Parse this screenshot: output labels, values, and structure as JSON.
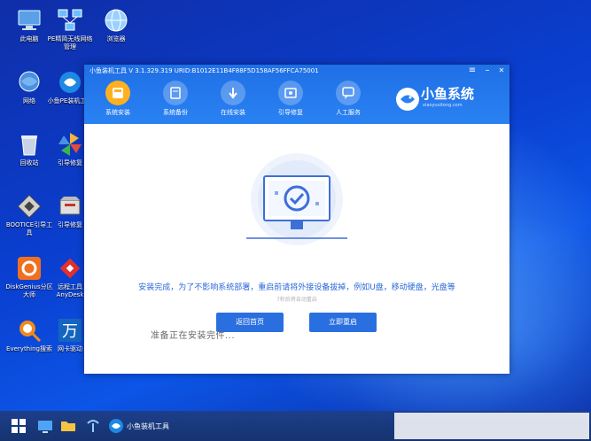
{
  "desktop": {
    "icons": [
      {
        "label": "此电脑",
        "icon": "computer-icon",
        "color": "#5aa0e8"
      },
      {
        "label": "PE精简无线网络管理",
        "icon": "network-icon",
        "color": "#6cc0ff"
      },
      {
        "label": "浏览器",
        "icon": "globe-icon",
        "color": "#9ad0ff"
      },
      {
        "label": "网络",
        "icon": "network-globe-icon",
        "color": "#4a90e2"
      },
      {
        "label": "小鱼PE装机工具",
        "icon": "fish-tool-icon",
        "color": "#1e88e5"
      },
      {
        "label": "回收站",
        "icon": "recycle-bin-icon",
        "color": "#c8d4e6"
      },
      {
        "label": "引导修复",
        "icon": "pinwheel-icon",
        "color": "#f5b43c"
      },
      {
        "label": "BOOTICE引导工具",
        "icon": "bootice-icon",
        "color": "#d0d0d0"
      },
      {
        "label": "引导修复",
        "icon": "boot-repair-icon",
        "color": "#e0e0e0"
      },
      {
        "label": "DiskGenius分区大师",
        "icon": "diskgenius-icon",
        "color": "#f07020"
      },
      {
        "label": "远程工具AnyDesk",
        "icon": "anydesk-icon",
        "color": "#e23030"
      },
      {
        "label": "Everything搜索",
        "icon": "everything-icon",
        "color": "#f08a1c"
      },
      {
        "label": "网卡驱动",
        "icon": "wan-icon",
        "color": "#1565c0"
      }
    ]
  },
  "window": {
    "title": "小鱼装机工具 V 3.1.329.319 URID:B1012E11B4F88F5D158AF56FFCA75001",
    "controls": {
      "menu": "≡",
      "minimize": "–",
      "close": "✕"
    },
    "tabs": [
      {
        "label": "系统安装",
        "icon": "install-icon",
        "active": true
      },
      {
        "label": "系统备份",
        "icon": "backup-icon",
        "active": false
      },
      {
        "label": "在线安装",
        "icon": "download-icon",
        "active": false
      },
      {
        "label": "引导修复",
        "icon": "repair-icon",
        "active": false
      },
      {
        "label": "人工服务",
        "icon": "chat-icon",
        "active": false
      }
    ],
    "brand": {
      "name": "小鱼系统",
      "url": "xiaoyuxitong.com"
    },
    "message": "安装完成，为了不影响系统部署，重启前请将外接设备拔掉，例如U盘，移动硬盘，光盘等",
    "countdown": "7秒后将自动重启",
    "buttons": {
      "back": "返回首页",
      "restart": "立即重启"
    }
  },
  "overlay_text": "准备正在安装完件...",
  "taskbar": {
    "app_label": "小鱼装机工具"
  },
  "colors": {
    "accent": "#2a6fe0",
    "active_tab": "#ffb020",
    "header": "#1f6fe6"
  }
}
